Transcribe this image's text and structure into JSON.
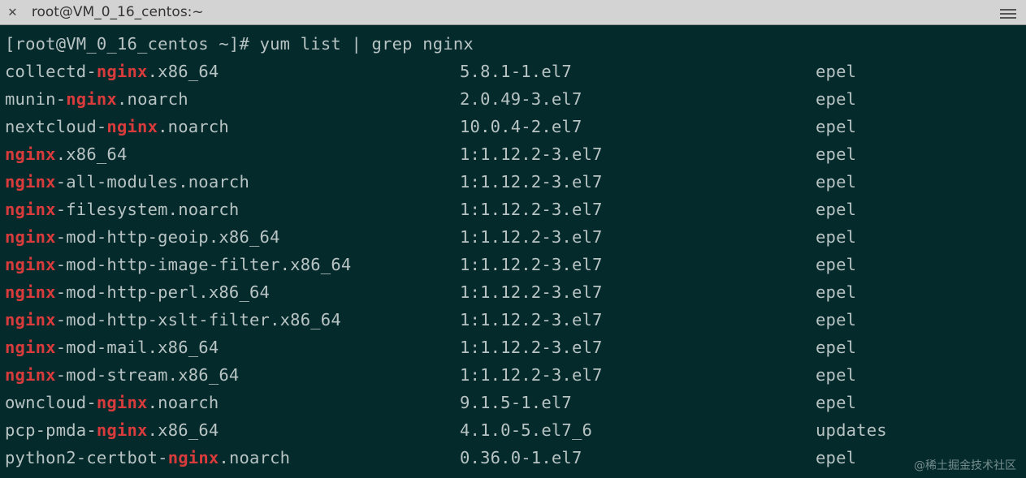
{
  "window": {
    "title": "root@VM_0_16_centos:~"
  },
  "terminal": {
    "prompt": "[root@VM_0_16_centos ~]# ",
    "command": "yum list | grep nginx",
    "highlight": "nginx",
    "rows": [
      {
        "pkg_pre": "collectd-",
        "pkg_hl": "nginx",
        "pkg_post": ".x86_64",
        "ver": "5.8.1-1.el7",
        "repo": "epel"
      },
      {
        "pkg_pre": "munin-",
        "pkg_hl": "nginx",
        "pkg_post": ".noarch",
        "ver": "2.0.49-3.el7",
        "repo": "epel"
      },
      {
        "pkg_pre": "nextcloud-",
        "pkg_hl": "nginx",
        "pkg_post": ".noarch",
        "ver": "10.0.4-2.el7",
        "repo": "epel"
      },
      {
        "pkg_pre": "",
        "pkg_hl": "nginx",
        "pkg_post": ".x86_64",
        "ver": "1:1.12.2-3.el7",
        "repo": "epel"
      },
      {
        "pkg_pre": "",
        "pkg_hl": "nginx",
        "pkg_post": "-all-modules.noarch",
        "ver": "1:1.12.2-3.el7",
        "repo": "epel"
      },
      {
        "pkg_pre": "",
        "pkg_hl": "nginx",
        "pkg_post": "-filesystem.noarch",
        "ver": "1:1.12.2-3.el7",
        "repo": "epel"
      },
      {
        "pkg_pre": "",
        "pkg_hl": "nginx",
        "pkg_post": "-mod-http-geoip.x86_64",
        "ver": "1:1.12.2-3.el7",
        "repo": "epel"
      },
      {
        "pkg_pre": "",
        "pkg_hl": "nginx",
        "pkg_post": "-mod-http-image-filter.x86_64",
        "ver": "1:1.12.2-3.el7",
        "repo": "epel"
      },
      {
        "pkg_pre": "",
        "pkg_hl": "nginx",
        "pkg_post": "-mod-http-perl.x86_64",
        "ver": "1:1.12.2-3.el7",
        "repo": "epel"
      },
      {
        "pkg_pre": "",
        "pkg_hl": "nginx",
        "pkg_post": "-mod-http-xslt-filter.x86_64",
        "ver": "1:1.12.2-3.el7",
        "repo": "epel"
      },
      {
        "pkg_pre": "",
        "pkg_hl": "nginx",
        "pkg_post": "-mod-mail.x86_64",
        "ver": "1:1.12.2-3.el7",
        "repo": "epel"
      },
      {
        "pkg_pre": "",
        "pkg_hl": "nginx",
        "pkg_post": "-mod-stream.x86_64",
        "ver": "1:1.12.2-3.el7",
        "repo": "epel"
      },
      {
        "pkg_pre": "owncloud-",
        "pkg_hl": "nginx",
        "pkg_post": ".noarch",
        "ver": "9.1.5-1.el7",
        "repo": "epel"
      },
      {
        "pkg_pre": "pcp-pmda-",
        "pkg_hl": "nginx",
        "pkg_post": ".x86_64",
        "ver": "4.1.0-5.el7_6",
        "repo": "updates"
      },
      {
        "pkg_pre": "python2-certbot-",
        "pkg_hl": "nginx",
        "pkg_post": ".noarch",
        "ver": "0.36.0-1.el7",
        "repo": "epel"
      }
    ]
  },
  "watermark": "@稀土掘金技术社区"
}
